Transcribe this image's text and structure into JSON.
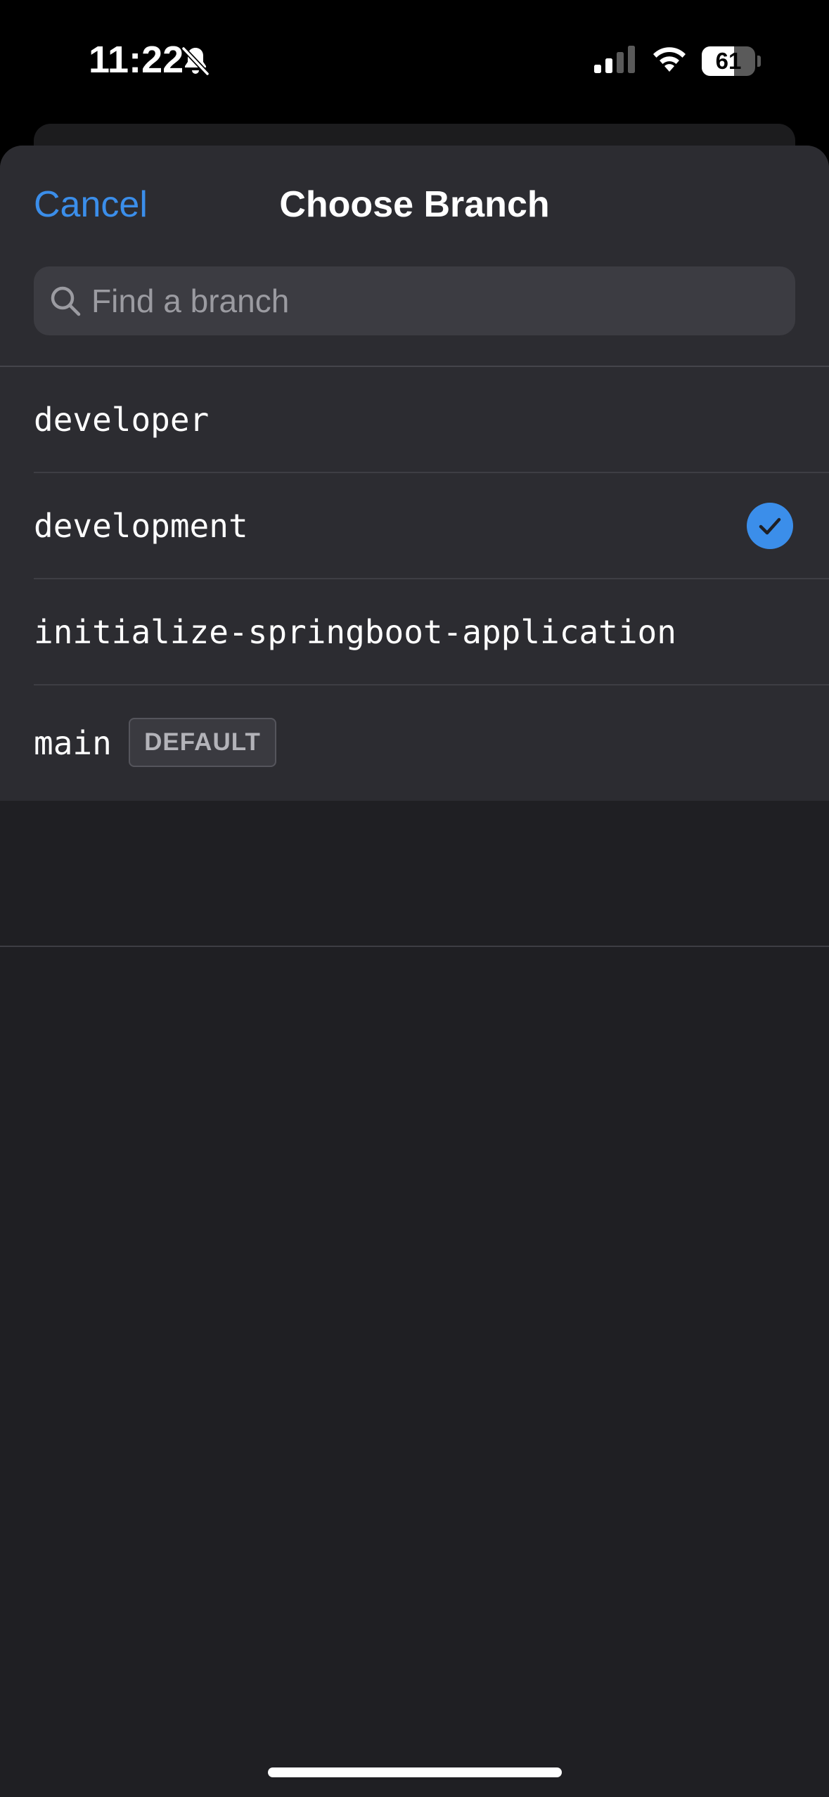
{
  "status_bar": {
    "time": "11:22",
    "battery_percent": "61",
    "battery_level": 0.61,
    "icons": [
      "bell-slash-icon",
      "cellular-signal-icon",
      "wifi-icon",
      "battery-icon"
    ]
  },
  "sheet": {
    "title": "Choose Branch",
    "cancel_label": "Cancel",
    "search": {
      "placeholder": "Find a branch",
      "value": ""
    }
  },
  "branches": [
    {
      "name": "developer",
      "selected": false
    },
    {
      "name": "development",
      "selected": true
    },
    {
      "name": "initialize-springboot-application",
      "selected": false
    },
    {
      "name": "main",
      "selected": false,
      "badge": "DEFAULT"
    }
  ],
  "colors": {
    "accent": "#3b8eea",
    "sheet_background": "#2c2c31",
    "page_background": "#1f1f23",
    "check_fill": "#3b8eea"
  }
}
